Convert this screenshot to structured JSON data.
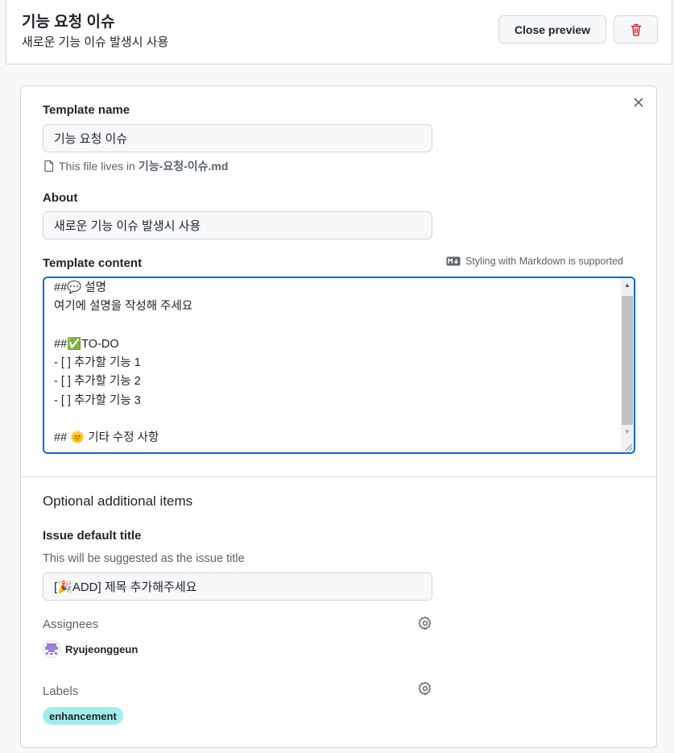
{
  "header": {
    "title": "기능 요청 이슈",
    "subtitle": "새로운 기능 이슈 발생시 사용",
    "close_preview_label": "Close preview"
  },
  "form": {
    "template_name_label": "Template name",
    "template_name_value": "기능 요청 이슈",
    "file_note_prefix": "This file lives in",
    "file_name": "기능-요청-이슈.md",
    "about_label": "About",
    "about_value": "새로운 기능 이슈 발생시 사용",
    "content_label": "Template content",
    "markdown_note": "Styling with Markdown is supported",
    "content_lines": [
      {
        "prefix": "##",
        "emoji": "💬",
        "text": " 설명"
      },
      {
        "prefix": "",
        "emoji": "",
        "text": "여기에 설명을 작성해 주세요"
      },
      {
        "prefix": "",
        "emoji": "",
        "text": ""
      },
      {
        "prefix": "##",
        "emoji": "✅",
        "text": "TO-DO"
      },
      {
        "prefix": "",
        "emoji": "",
        "text": "- [ ] 추가할 기능 1"
      },
      {
        "prefix": "",
        "emoji": "",
        "text": "- [ ] 추가할 기능 2"
      },
      {
        "prefix": "",
        "emoji": "",
        "text": "- [ ] 추가할 기능 3"
      },
      {
        "prefix": "",
        "emoji": "",
        "text": ""
      },
      {
        "prefix": "## ",
        "emoji": "🌞",
        "text": " 기타 수정 사항"
      }
    ]
  },
  "optional": {
    "section_title": "Optional additional items",
    "issue_title_label": "Issue default title",
    "issue_title_hint": "This will be suggested as the issue title",
    "issue_title_value": "[🎉ADD] 제목 추가해주세요",
    "assignees_label": "Assignees",
    "assignee_name": "Ryujeonggeun",
    "labels_label": "Labels",
    "label_badge": "enhancement"
  },
  "colors": {
    "accent": "#0969da",
    "danger": "#cf222e",
    "label_bg": "#a2eeef"
  },
  "icons": [
    "trash-icon",
    "close-icon",
    "file-icon",
    "markdown-icon",
    "gear-icon"
  ]
}
